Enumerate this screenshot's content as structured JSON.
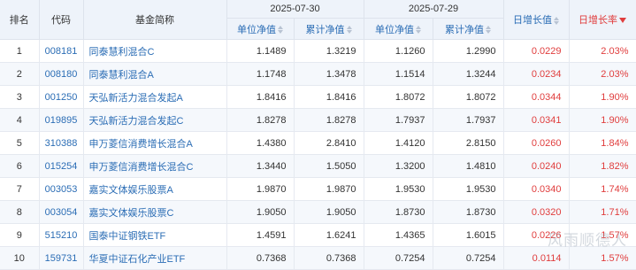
{
  "headers": {
    "rank": "排名",
    "code": "代码",
    "name": "基金简称",
    "date1": "2025-07-30",
    "date2": "2025-07-29",
    "unit_nav": "单位净值",
    "acc_nav": "累计净值",
    "daily_change": "日增长值",
    "daily_rate": "日增长率"
  },
  "rows": [
    {
      "rank": "1",
      "code": "008181",
      "name": "同泰慧利混合C",
      "unit1": "1.1489",
      "acc1": "1.3219",
      "unit2": "1.1260",
      "acc2": "1.2990",
      "change": "0.0229",
      "rate": "2.03%"
    },
    {
      "rank": "2",
      "code": "008180",
      "name": "同泰慧利混合A",
      "unit1": "1.1748",
      "acc1": "1.3478",
      "unit2": "1.1514",
      "acc2": "1.3244",
      "change": "0.0234",
      "rate": "2.03%"
    },
    {
      "rank": "3",
      "code": "001250",
      "name": "天弘新活力混合发起A",
      "unit1": "1.8416",
      "acc1": "1.8416",
      "unit2": "1.8072",
      "acc2": "1.8072",
      "change": "0.0344",
      "rate": "1.90%"
    },
    {
      "rank": "4",
      "code": "019895",
      "name": "天弘新活力混合发起C",
      "unit1": "1.8278",
      "acc1": "1.8278",
      "unit2": "1.7937",
      "acc2": "1.7937",
      "change": "0.0341",
      "rate": "1.90%"
    },
    {
      "rank": "5",
      "code": "310388",
      "name": "申万菱信消费增长混合A",
      "unit1": "1.4380",
      "acc1": "2.8410",
      "unit2": "1.4120",
      "acc2": "2.8150",
      "change": "0.0260",
      "rate": "1.84%"
    },
    {
      "rank": "6",
      "code": "015254",
      "name": "申万菱信消费增长混合C",
      "unit1": "1.3440",
      "acc1": "1.5050",
      "unit2": "1.3200",
      "acc2": "1.4810",
      "change": "0.0240",
      "rate": "1.82%"
    },
    {
      "rank": "7",
      "code": "003053",
      "name": "嘉实文体娱乐股票A",
      "unit1": "1.9870",
      "acc1": "1.9870",
      "unit2": "1.9530",
      "acc2": "1.9530",
      "change": "0.0340",
      "rate": "1.74%"
    },
    {
      "rank": "8",
      "code": "003054",
      "name": "嘉实文体娱乐股票C",
      "unit1": "1.9050",
      "acc1": "1.9050",
      "unit2": "1.8730",
      "acc2": "1.8730",
      "change": "0.0320",
      "rate": "1.71%"
    },
    {
      "rank": "9",
      "code": "515210",
      "name": "国泰中证钢铁ETF",
      "unit1": "1.4591",
      "acc1": "1.6241",
      "unit2": "1.4365",
      "acc2": "1.6015",
      "change": "0.0226",
      "rate": "1.57%"
    },
    {
      "rank": "10",
      "code": "159731",
      "name": "华夏中证石化产业ETF",
      "unit1": "0.7368",
      "acc1": "0.7368",
      "unit2": "0.7254",
      "acc2": "0.7254",
      "change": "0.0114",
      "rate": "1.57%"
    }
  ],
  "watermark": "风雨顺德人",
  "colors": {
    "link": "#2b6db5",
    "positive": "#e03d3d",
    "header_bg": "#eef3fa"
  }
}
